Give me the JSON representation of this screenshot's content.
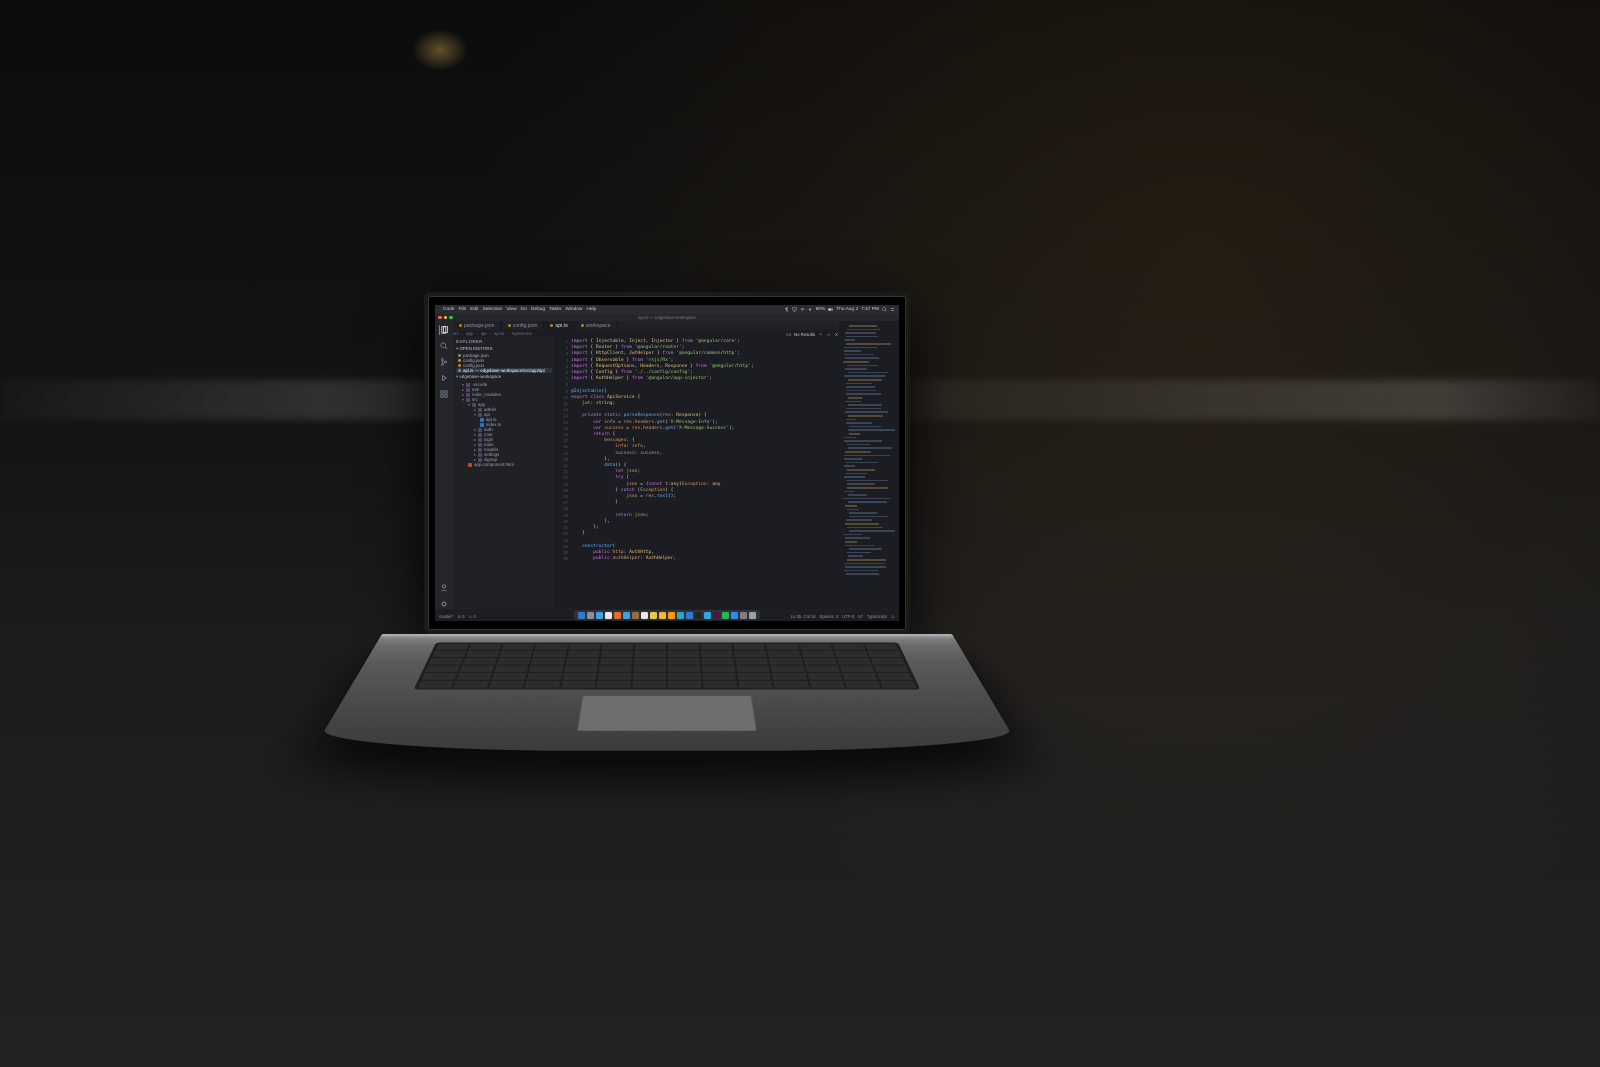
{
  "menubar": {
    "app": "Code",
    "items": [
      "File",
      "Edit",
      "Selection",
      "View",
      "Go",
      "Debug",
      "Tasks",
      "Window",
      "Help"
    ],
    "battery": "80%",
    "date": "Thu Aug 2",
    "time": "7:47 PM",
    "icons": [
      "bluetooth",
      "airplay",
      "wifi",
      "volume",
      "battery",
      "spotlight",
      "control-center",
      "siri"
    ]
  },
  "window": {
    "title": "api.ts — edgebase-workspace"
  },
  "tabs": [
    {
      "label": "package.json",
      "active": false
    },
    {
      "label": "config.json",
      "active": false
    },
    {
      "label": "api.ts",
      "active": true
    },
    {
      "label": "workspace",
      "active": false
    }
  ],
  "breadcrumbs": [
    "src",
    "app",
    "api",
    "api.ts",
    "ApiService"
  ],
  "search": {
    "no_results": "No Results",
    "counter": "0/0"
  },
  "activity": [
    "explorer",
    "search",
    "scm",
    "debug",
    "extensions"
  ],
  "sidebar": {
    "title": "EXPLORER",
    "open_editors_label": "OPEN EDITORS",
    "open_editors": [
      {
        "name": "package.json",
        "modified": false
      },
      {
        "name": "config.json",
        "modified": true
      },
      {
        "name": "config.json",
        "modified": true
      },
      {
        "name": "api.ts — edgebase-workspace/src/app/api",
        "modified": false,
        "selected": true
      }
    ],
    "workspace_label": "edgebase-workspace",
    "tree": [
      {
        "d": 0,
        "t": "folder",
        "open": true,
        "n": ".vscode"
      },
      {
        "d": 0,
        "t": "folder",
        "open": false,
        "n": "e2e"
      },
      {
        "d": 0,
        "t": "folder",
        "open": false,
        "n": "node_modules"
      },
      {
        "d": 0,
        "t": "folder",
        "open": true,
        "n": "src"
      },
      {
        "d": 1,
        "t": "folder",
        "open": true,
        "n": "app"
      },
      {
        "d": 2,
        "t": "folder",
        "open": false,
        "n": "admin"
      },
      {
        "d": 2,
        "t": "folder",
        "open": true,
        "n": "api"
      },
      {
        "d": 3,
        "t": "ts",
        "n": "api.ts"
      },
      {
        "d": 3,
        "t": "ts",
        "n": "index.ts"
      },
      {
        "d": 2,
        "t": "folder",
        "open": false,
        "n": "auth"
      },
      {
        "d": 2,
        "t": "folder",
        "open": false,
        "n": "core"
      },
      {
        "d": 2,
        "t": "folder",
        "open": false,
        "n": "login"
      },
      {
        "d": 2,
        "t": "folder",
        "open": false,
        "n": "main"
      },
      {
        "d": 2,
        "t": "folder",
        "open": false,
        "n": "models"
      },
      {
        "d": 2,
        "t": "folder",
        "open": false,
        "n": "settings"
      },
      {
        "d": 2,
        "t": "folder",
        "open": false,
        "n": "signup"
      },
      {
        "d": 1,
        "t": "html",
        "n": "app.component.html"
      }
    ]
  },
  "code": {
    "lines": [
      {
        "n": 1,
        "h": "<kw>import</kw> { <ty>Injectable</ty>, <ty>Inject</ty>, <ty>Injector</ty> } <kw>from</kw> <st>'@angular/core'</st>;"
      },
      {
        "n": 2,
        "h": "<kw>import</kw> { <ty>Router</ty> } <kw>from</kw> <st>'@angular/router'</st>;"
      },
      {
        "n": 3,
        "h": "<kw>import</kw> { <ty>HttpClient</ty>, <ty>JwtHelper</ty> } <kw>from</kw> <st>'@angular/common/http'</st>;"
      },
      {
        "n": 4,
        "h": "<kw>import</kw> { <ty>Observable</ty> } <kw>from</kw> <st>'rxjs/Rx'</st>;"
      },
      {
        "n": 5,
        "h": "<kw>import</kw> { <ty>RequestOptions</ty>, <ty>Headers</ty>, <ty>Response</ty> } <kw>from</kw> <st>'@angular/http'</st>;"
      },
      {
        "n": 6,
        "h": "<kw>import</kw> { <ty>Config</ty> } <kw>from</kw> <st>'./../config/config'</st>;"
      },
      {
        "n": 7,
        "h": "<kw>import</kw> { <ty>AuthHelper</ty> } <kw>from</kw> <st>'@angular/app-injector'</st>;"
      },
      {
        "n": 8,
        "h": ""
      },
      {
        "n": 9,
        "h": "<fn>@Injectable</fn>()"
      },
      {
        "n": 10,
        "h": "<kw>export</kw> <kw>class</kw> <ty>ApiService</ty> {"
      },
      {
        "n": 11,
        "h": "    <va>jwt</va>: <ty>string</ty>;"
      },
      {
        "n": 12,
        "h": ""
      },
      {
        "n": 13,
        "h": "    <kw>private</kw> <kw>static</kw> <fn>parseResponse</fn>(<va>res</va>: <ty>Response</ty>) {"
      },
      {
        "n": 14,
        "h": "        <kw>var</kw> <va>info</va> = <va>res</va>.<va>headers</va>.<fn>get</fn>(<st>'X-Message-Info'</st>);"
      },
      {
        "n": 15,
        "h": "        <kw>var</kw> <va>success</va> = <va>res</va>.<va>headers</va>.<fn>get</fn>(<st>'X-Message-Success'</st>);"
      },
      {
        "n": 16,
        "h": "        <kw>return</kw> {"
      },
      {
        "n": 17,
        "h": "            <va>messages</va>: {"
      },
      {
        "n": 18,
        "h": "                <va>info</va>: <va>info</va>,"
      },
      {
        "n": 19,
        "h": "                <va>success</va>: <va>success</va>,"
      },
      {
        "n": 20,
        "h": "            },"
      },
      {
        "n": 21,
        "h": "            <fn>data</fn>() {"
      },
      {
        "n": 22,
        "h": "                <kw>let</kw> <va>json</va>;"
      },
      {
        "n": 23,
        "h": "                <kw>try</kw> {"
      },
      {
        "n": 24,
        "h": "                    <va>json</va> = (<kw>const</kw> <va>t</va>:<ty>any</ty>)<va>Exception</va>: <ty>any</ty>"
      },
      {
        "n": 25,
        "h": "                } <kw>catch</kw> (<va>Exception</va>) {"
      },
      {
        "n": 26,
        "h": "                    <va>json</va> = <va>res</va>.<fn>text</fn>();"
      },
      {
        "n": 27,
        "h": "                }"
      },
      {
        "n": 28,
        "h": ""
      },
      {
        "n": 29,
        "h": "                <kw>return</kw> <va>json</va>;"
      },
      {
        "n": 30,
        "h": "            },"
      },
      {
        "n": 31,
        "h": "        };"
      },
      {
        "n": 32,
        "h": "    }"
      },
      {
        "n": 33,
        "h": ""
      },
      {
        "n": 34,
        "h": "    <fn>constructor</fn>("
      },
      {
        "n": 35,
        "h": "        <kw>public</kw> <va>http</va>: <ty>AuthHttp</ty>,"
      },
      {
        "n": 36,
        "h": "        <kw>public</kw> <va>authHelper</va>: <ty>AuthHelper</ty>,"
      }
    ]
  },
  "statusbar": {
    "left": [
      "master*",
      "⊘ 0",
      "⚠ 0"
    ],
    "right": [
      "Ln 35, Col 18",
      "Spaces: 4",
      "UTF-8",
      "LF",
      "TypeScript",
      "☺"
    ]
  },
  "dock": [
    {
      "n": "finder",
      "c": "#2d7bd6"
    },
    {
      "n": "launchpad",
      "c": "#8a8f99"
    },
    {
      "n": "safari",
      "c": "#3ea2e8"
    },
    {
      "n": "chrome",
      "c": "#e8e8e8"
    },
    {
      "n": "firefox",
      "c": "#e86b2d"
    },
    {
      "n": "mail",
      "c": "#3aa0e8"
    },
    {
      "n": "contacts",
      "c": "#9b6b43"
    },
    {
      "n": "calendar",
      "c": "#e8e8e8"
    },
    {
      "n": "notes",
      "c": "#e8c94a"
    },
    {
      "n": "sketch",
      "c": "#f7b53c"
    },
    {
      "n": "illustrator",
      "c": "#ff9a00"
    },
    {
      "n": "photoshop",
      "c": "#2da4c9"
    },
    {
      "n": "vscode",
      "c": "#2b7bd1"
    },
    {
      "n": "terminal",
      "c": "#222"
    },
    {
      "n": "skype",
      "c": "#2aa8e0"
    },
    {
      "n": "slack",
      "c": "#4a154b"
    },
    {
      "n": "spotify",
      "c": "#1db954"
    },
    {
      "n": "appstore",
      "c": "#2c8de8"
    },
    {
      "n": "preferences",
      "c": "#7d8088"
    },
    {
      "n": "trash",
      "c": "#9aa0a8"
    }
  ]
}
